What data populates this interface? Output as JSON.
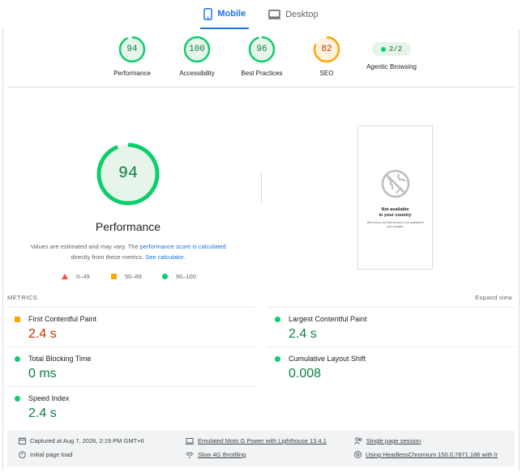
{
  "tabs": [
    {
      "label": "Mobile",
      "icon": "mobile-icon",
      "active": true
    },
    {
      "label": "Desktop",
      "icon": "desktop-icon",
      "active": false
    }
  ],
  "categories": [
    {
      "score": "94",
      "label": "Performance",
      "color": "#0cce6b"
    },
    {
      "score": "100",
      "label": "Accessibility",
      "color": "#0cce6b"
    },
    {
      "score": "96",
      "label": "Best Practices",
      "color": "#0cce6b"
    },
    {
      "score": "82",
      "label": "SEO",
      "color": "#ffa400"
    },
    {
      "score": "2/2",
      "label": "Agentic Browsing",
      "color": "#0cce6b"
    }
  ],
  "main": {
    "score": "94",
    "title": "Performance",
    "note_part1": "Values are estimated and may vary. The ",
    "note_link1": "performance score is calculated",
    "note_part2": " directly from these metrics. ",
    "note_link2": "See calculator.",
    "legend": [
      "0–49",
      "50–89",
      "90–100"
    ]
  },
  "screenshot": {
    "title_line1": "Not available",
    "title_line2": "in your country",
    "body": "We're sorry, but this service is not available in your location."
  },
  "metrics": {
    "heading": "METRICS",
    "expand_label": "Expand view",
    "items": [
      {
        "name": "First Contentful Paint",
        "value": "2.4 s",
        "status": "average"
      },
      {
        "name": "Largest Contentful Paint",
        "value": "2.4 s",
        "status": "pass"
      },
      {
        "name": "Total Blocking Time",
        "value": "0 ms",
        "status": "pass"
      },
      {
        "name": "Cumulative Layout Shift",
        "value": "0.008",
        "status": "pass"
      },
      {
        "name": "Speed Index",
        "value": "2.4 s",
        "status": "pass"
      }
    ]
  },
  "footer": {
    "captured": "Captured at Aug 7, 2026, 2:19 PM GMT+6",
    "device": "Emulated Moto G Power with Lighthouse 13.4.1",
    "session": "Single page session",
    "load": "Initial page load",
    "throttling": "Slow 4G throttling",
    "browser": "Using HeadlessChromium 150.0.7871.186 with lr"
  },
  "colors": {
    "pass": "#0cce6b",
    "average": "#ffa400",
    "fail": "#ff4e42",
    "accent": "#1a73e8"
  }
}
